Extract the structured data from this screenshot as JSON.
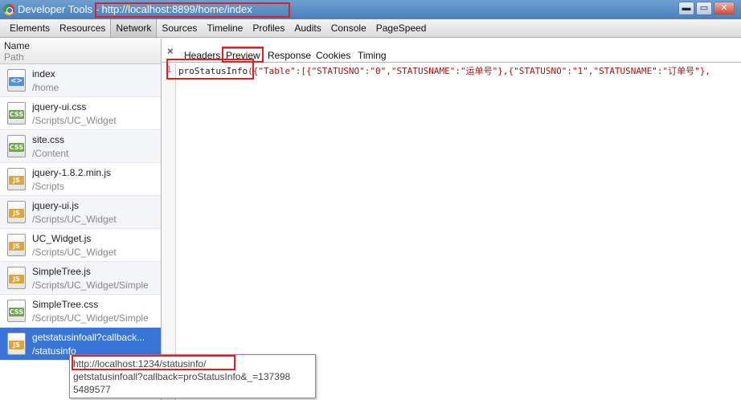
{
  "window": {
    "title": "Developer Tools",
    "separator": " - ",
    "url": "http://localhost:8899/home/index",
    "buttons": {
      "minimize": "▬",
      "maximize": "▭",
      "close": "✕"
    }
  },
  "panels": [
    "Elements",
    "Resources",
    "Network",
    "Sources",
    "Timeline",
    "Profiles",
    "Audits",
    "Console",
    "PageSpeed"
  ],
  "active_panel": "Network",
  "list_header": {
    "name": "Name",
    "path": "Path"
  },
  "requests": [
    {
      "name": "index",
      "path": "/home",
      "icon": "doc-icon"
    },
    {
      "name": "jquery-ui.css",
      "path": "/Scripts/UC_Widget",
      "icon": "css-icon"
    },
    {
      "name": "site.css",
      "path": "/Content",
      "icon": "css-icon"
    },
    {
      "name": "jquery-1.8.2.min.js",
      "path": "/Scripts",
      "icon": "js-icon"
    },
    {
      "name": "jquery-ui.js",
      "path": "/Scripts/UC_Widget",
      "icon": "js-icon"
    },
    {
      "name": "UC_Widget.js",
      "path": "/Scripts/UC_Widget",
      "icon": "js-icon"
    },
    {
      "name": "SimpleTree.js",
      "path": "/Scripts/UC_Widget/Simple",
      "icon": "js-icon"
    },
    {
      "name": "SimpleTree.css",
      "path": "/Scripts/UC_Widget/Simple",
      "icon": "css-icon"
    },
    {
      "name": "getstatusinfoall?callback...",
      "path": "/statusinfo",
      "icon": "js-icon"
    }
  ],
  "icon_labels": {
    "doc": "<>",
    "css": "CSS",
    "js": "JS"
  },
  "detail_tabs": [
    "Headers",
    "Preview",
    "Response",
    "Cookies",
    "Timing"
  ],
  "close_label": "×",
  "preview": {
    "line_number": "1",
    "callback_name": "proStatusInfo",
    "json_text": "({\"Table\":[{\"STATUSNO\":\"0\",\"STATUSNAME\":\"运单号\"},{\"STATUSNO\":\"1\",\"STATUSNAME\":\"订单号\"},"
  },
  "tooltip": {
    "line1": "http://localhost:1234/statusinfo/",
    "line2": "getstatusinfoall?callback=proStatusInfo&_=137398",
    "line3": "5489577"
  },
  "colors": {
    "highlight": "#e02020",
    "selected_row": "#3875d7",
    "titlebar": "#4a7fbd"
  }
}
